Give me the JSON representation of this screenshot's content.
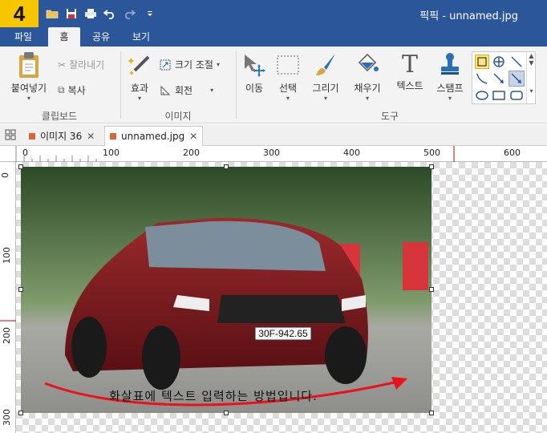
{
  "app": {
    "logo": "4",
    "title": "픽픽 - unnamed.jpg"
  },
  "menu_tabs": [
    {
      "label": "파일"
    },
    {
      "label": "홈"
    },
    {
      "label": "공유"
    },
    {
      "label": "보기"
    }
  ],
  "ribbon": {
    "clipboard": {
      "paste": "붙여넣기",
      "cut": "잘라내기",
      "copy": "복사",
      "group": "클립보드"
    },
    "image": {
      "effects": "효과",
      "resize": "크기 조절",
      "rotate": "회전",
      "group": "이미지"
    },
    "tools": {
      "move": "이동",
      "select": "선택",
      "draw": "그리기",
      "fill": "채우기",
      "text": "텍스트",
      "text_glyph": "T",
      "stamp": "스탬프",
      "group": "도구"
    }
  },
  "doc_tabs": [
    {
      "label": "이미지 36"
    },
    {
      "label": "unnamed.jpg"
    }
  ],
  "ruler": {
    "h_labels": [
      "0",
      "100",
      "200",
      "300",
      "400",
      "500",
      "600"
    ],
    "v_labels": [
      "0",
      "100",
      "200",
      "300"
    ]
  },
  "canvas": {
    "license_plate": "30F-942.65",
    "caption": "화살표에 텍스트 입력하는 방법입니다."
  }
}
